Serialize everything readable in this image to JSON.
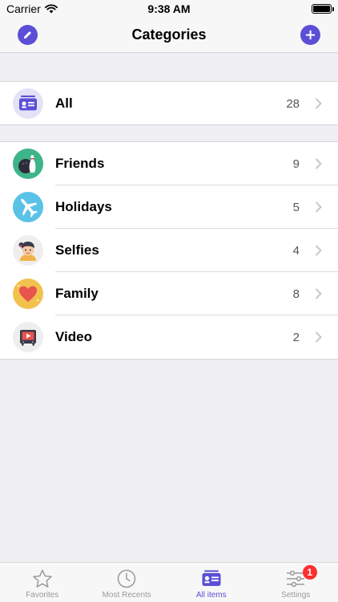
{
  "status_bar": {
    "carrier": "Carrier",
    "time": "9:38 AM"
  },
  "nav": {
    "title": "Categories",
    "left_icon": "pencil-icon",
    "right_icon": "plus-icon"
  },
  "all_row": {
    "label": "All",
    "count": "28",
    "icon": "id-card-icon"
  },
  "categories": [
    {
      "label": "Friends",
      "count": "9",
      "icon": "bowling-icon",
      "color": "#3eb489"
    },
    {
      "label": "Holidays",
      "count": "5",
      "icon": "airplane-icon",
      "color": "#5bc2e7"
    },
    {
      "label": "Selfies",
      "count": "4",
      "icon": "girl-face-icon",
      "color": "#eeeeee"
    },
    {
      "label": "Family",
      "count": "8",
      "icon": "heart-icon",
      "color": "#f2c14e"
    },
    {
      "label": "Video",
      "count": "2",
      "icon": "tv-icon",
      "color": "#eeeeee"
    }
  ],
  "tabs": [
    {
      "label": "Favorites",
      "icon": "star-icon"
    },
    {
      "label": "Most Recents",
      "icon": "clock-icon"
    },
    {
      "label": "All items",
      "icon": "id-card-icon"
    },
    {
      "label": "Settings",
      "icon": "sliders-icon",
      "badge": "1"
    }
  ],
  "colors": {
    "accent": "#5b4fd6",
    "badge": "#ff2e2e",
    "background": "#efeff4"
  }
}
